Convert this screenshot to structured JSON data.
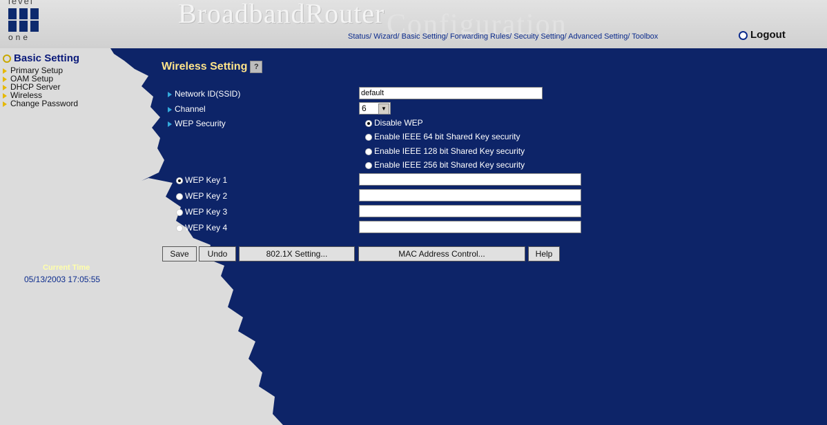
{
  "colors": {
    "background_blue": "#0d2468",
    "sidebar_gray": "#dcdcdc",
    "title_yellow": "#ffe48a",
    "link_blue": "#0a2a8c"
  },
  "header": {
    "logo_top": "level",
    "logo_bottom": "one",
    "brand": "BroadbandRouter",
    "brand_sub": "Configuration",
    "nav": "Status/ Wizard/ Basic Setting/ Forwarding Rules/ Secuity Setting/ Advanced Setting/ Toolbox",
    "logout": "Logout"
  },
  "sidebar": {
    "section": "Basic Setting",
    "items": [
      {
        "label": "Primary Setup"
      },
      {
        "label": "OAM Setup"
      },
      {
        "label": "DHCP Server"
      },
      {
        "label": "Wireless"
      },
      {
        "label": "Change Password"
      }
    ],
    "time_label": "Current Time",
    "time_value": "05/13/2003 17:05:55"
  },
  "main": {
    "title": "Wireless Setting",
    "help_icon": "help-icon",
    "ssid_label": "Network ID(SSID)",
    "ssid_value": "default",
    "channel_label": "Channel",
    "channel_value": "6",
    "wep_label": "WEP Security",
    "wep_options": [
      {
        "label": "Disable WEP",
        "selected": true
      },
      {
        "label": "Enable IEEE 64 bit Shared Key security",
        "selected": false
      },
      {
        "label": "Enable IEEE 128 bit Shared Key security",
        "selected": false
      },
      {
        "label": "Enable IEEE 256 bit Shared Key security",
        "selected": false
      }
    ],
    "wep_keys": [
      {
        "label": "WEP Key 1",
        "selected": true,
        "value": ""
      },
      {
        "label": "WEP Key 2",
        "selected": false,
        "value": ""
      },
      {
        "label": "WEP Key 3",
        "selected": false,
        "value": ""
      },
      {
        "label": "WEP Key 4",
        "selected": false,
        "value": ""
      }
    ],
    "buttons": {
      "save": "Save",
      "undo": "Undo",
      "dot1x": "802.1X Setting...",
      "mac": "MAC Address Control...",
      "help": "Help"
    }
  }
}
